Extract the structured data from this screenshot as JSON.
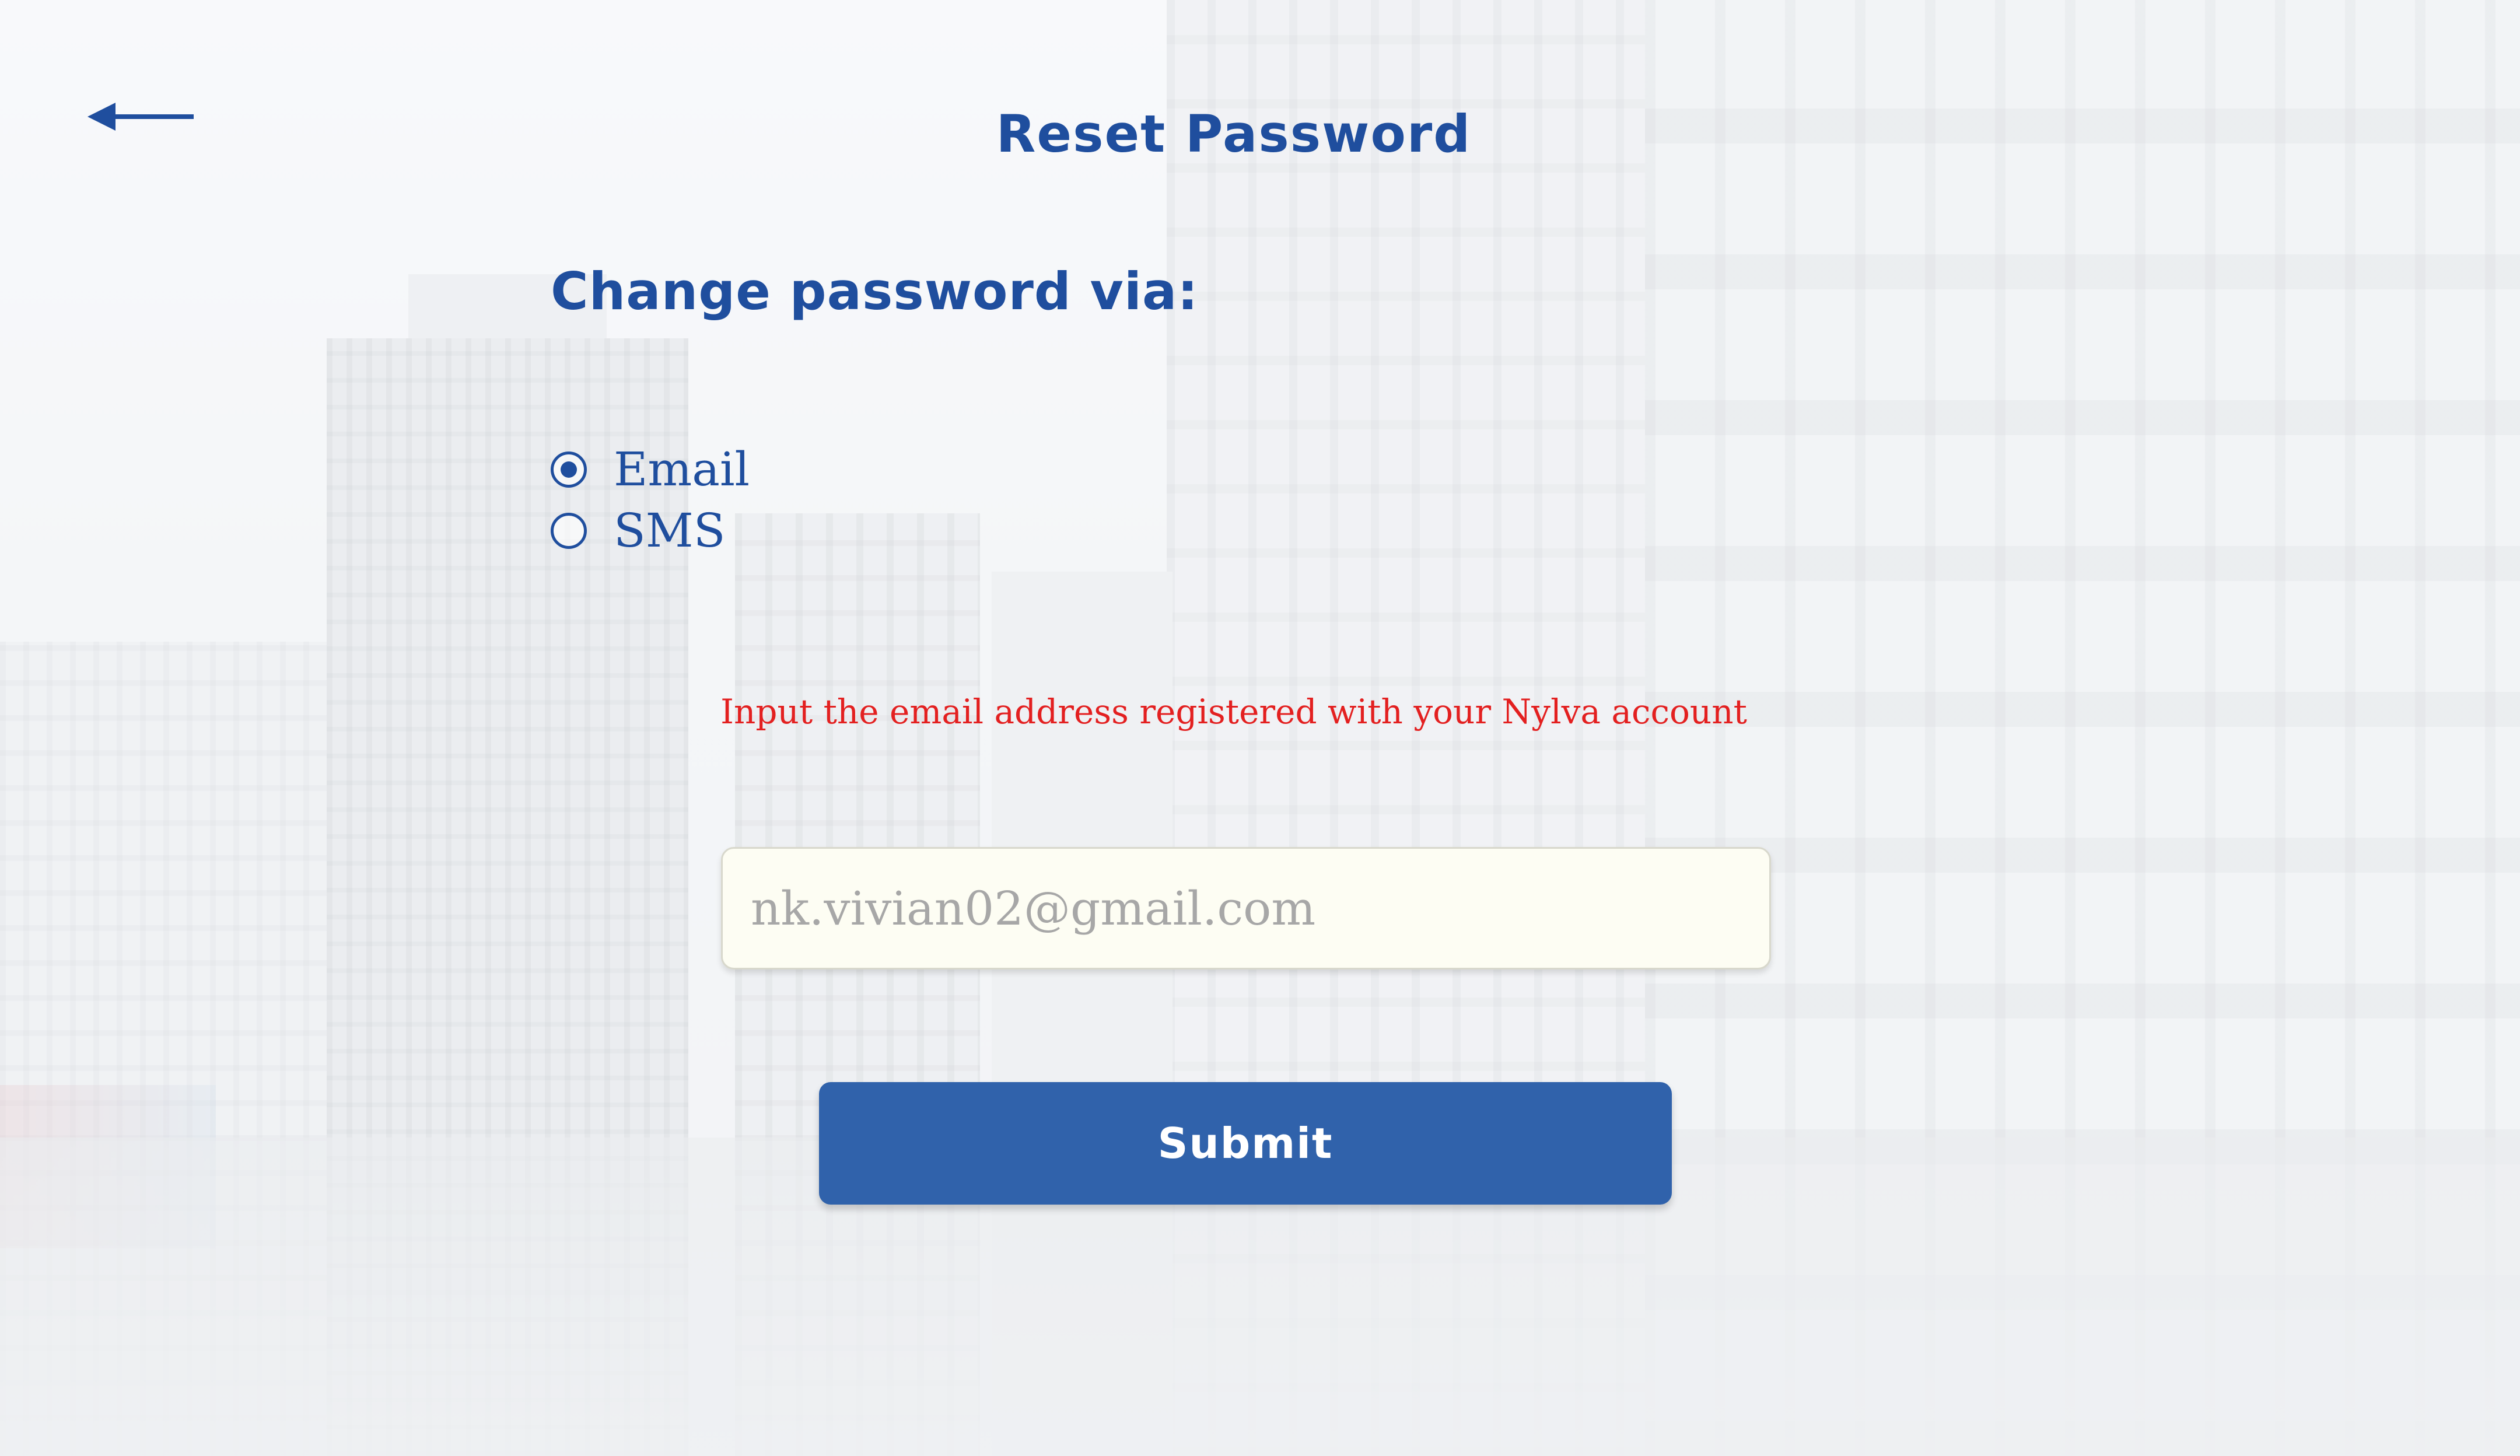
{
  "header": {
    "back_icon": "arrow-left-icon",
    "title": "Reset Password"
  },
  "form": {
    "heading": "Change password via:",
    "options": [
      {
        "label": "Email",
        "selected": true
      },
      {
        "label": "SMS",
        "selected": false
      }
    ],
    "hint": "Input the email address registered with your Nylva account",
    "email_value": "nk.vivian02@gmail.com",
    "submit_label": "Submit"
  },
  "colors": {
    "primary": "#1f4e9e",
    "button": "#3062ab",
    "hint": "#e32020",
    "input_bg": "#fdfdf3",
    "input_text": "#a7a7a7"
  }
}
